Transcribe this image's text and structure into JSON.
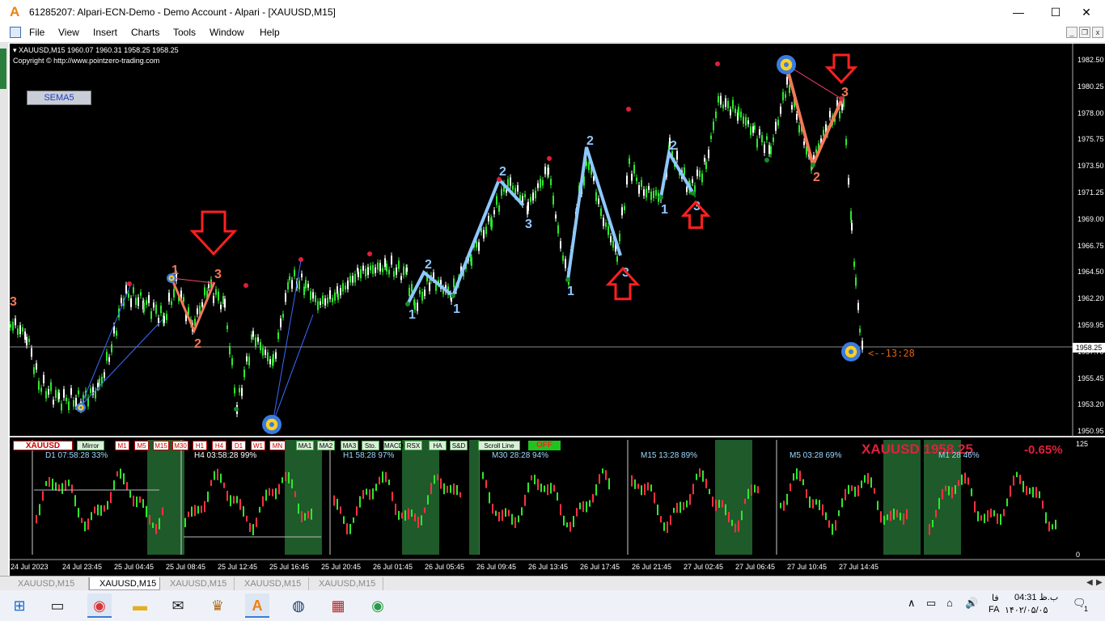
{
  "window": {
    "title": "61285207: Alpari-ECN-Demo - Demo Account - Alpari - [XAUUSD,M15]",
    "minimize": "—",
    "maximize": "☐",
    "close": "✕"
  },
  "menu": [
    "File",
    "View",
    "Insert",
    "Charts",
    "Tools",
    "Window",
    "Help"
  ],
  "chart": {
    "info": "▾ XAUUSD,M15  1960.07 1960.31 1958.25 1958.25",
    "copyright": "Copyright © http://www.pointzero-trading.com",
    "sema_button": "SEMA5",
    "timer": "<--13:28",
    "current_price": "1958.25",
    "price_levels": [
      "1982.50",
      "1980.25",
      "1978.00",
      "1975.75",
      "1973.50",
      "1971.25",
      "1969.00",
      "1966.75",
      "1964.50",
      "1962.20",
      "1959.95",
      "1957.70",
      "1955.45",
      "1953.20",
      "1950.95"
    ],
    "wave_labels": [
      {
        "t": "3",
        "c": "#f07858"
      },
      {
        "t": "1",
        "c": "#f07858"
      },
      {
        "t": "3",
        "c": "#f07858"
      },
      {
        "t": "2",
        "c": "#f07858"
      },
      {
        "t": "1",
        "c": "#8ec8ff"
      },
      {
        "t": "2",
        "c": "#8ec8ff"
      },
      {
        "t": "1",
        "c": "#8ec8ff"
      },
      {
        "t": "2",
        "c": "#8ec8ff"
      },
      {
        "t": "3",
        "c": "#8ec8ff"
      },
      {
        "t": "1",
        "c": "#8ec8ff"
      },
      {
        "t": "2",
        "c": "#8ec8ff"
      },
      {
        "t": "3",
        "c": "#8ec8ff"
      },
      {
        "t": "1",
        "c": "#8ec8ff"
      },
      {
        "t": "2",
        "c": "#8ec8ff"
      },
      {
        "t": "3",
        "c": "#8ec8ff"
      },
      {
        "t": "2",
        "c": "#f07858"
      },
      {
        "t": "3",
        "c": "#f07858"
      }
    ]
  },
  "panel": {
    "symbol": "XAUUSD",
    "mirror": "Mirror",
    "timeframes": [
      "M1",
      "M5",
      "M15",
      "M30",
      "H1",
      "H4",
      "D1",
      "W1",
      "MN"
    ],
    "indicators": [
      "MA1",
      "MA2",
      "MA3",
      "Sto.",
      "MACD",
      "RSX",
      "HA",
      "S&D"
    ],
    "scroll_line": "Scroll Line",
    "off": "OFF",
    "price_banner": "XAUUSD  1958.25",
    "price_change": "-0.65%",
    "scale_top": "125",
    "scale_bottom": "0",
    "mini_charts": [
      {
        "label": "D1   07:58:28   33%"
      },
      {
        "label": "H4   03:58:28   99%"
      },
      {
        "label": "H1   58:28   97%"
      },
      {
        "label": "M30   28:28   94%"
      },
      {
        "label": "M15   13:28   89%"
      },
      {
        "label": "M5   03:28   69%"
      },
      {
        "label": "M1   28   46%"
      }
    ]
  },
  "xaxis": [
    "24 Jul 2023",
    "24 Jul 23:45",
    "25 Jul 04:45",
    "25 Jul 08:45",
    "25 Jul 12:45",
    "25 Jul 16:45",
    "25 Jul 20:45",
    "26 Jul 01:45",
    "26 Jul 05:45",
    "26 Jul 09:45",
    "26 Jul 13:45",
    "26 Jul 17:45",
    "26 Jul 21:45",
    "27 Jul 02:45",
    "27 Jul 06:45",
    "27 Jul 10:45",
    "27 Jul 14:45"
  ],
  "tabs": [
    "XAUUSD,M15",
    "XAUUSD,M15",
    "XAUUSD,M15",
    "XAUUSD,M15",
    "XAUUSD,M15"
  ],
  "taskbar": {
    "clock_time": "04:31 ب.ظ",
    "clock_date": "۱۴۰۲/۰۵/۰۵",
    "lang": "FA",
    "lang2": "فا",
    "notify": "1"
  },
  "colors": {
    "bull": "#2ee82e",
    "wave_blue": "#8ec8ff",
    "wave_red": "#f07858",
    "arrow": "#ff2020",
    "banner": "#e0203a"
  }
}
